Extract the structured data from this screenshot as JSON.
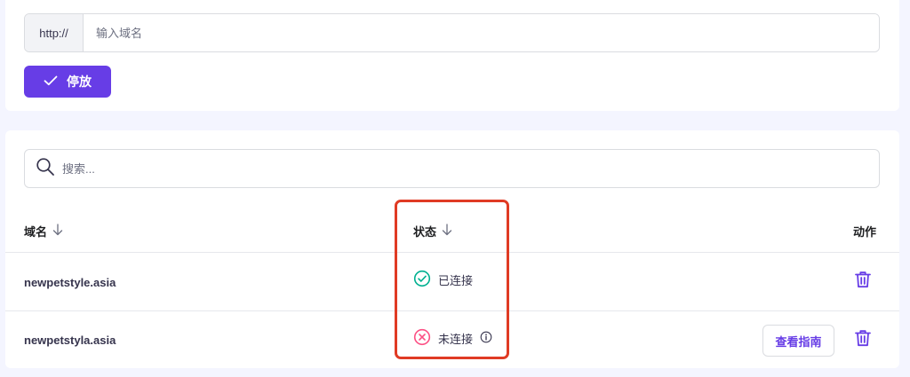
{
  "park_form": {
    "url_prefix": "http://",
    "domain_placeholder": "输入域名",
    "park_button_label": "停放"
  },
  "domains_table": {
    "search_placeholder": "搜索...",
    "columns": {
      "domain": "域名",
      "status": "状态",
      "action": "动作"
    },
    "rows": [
      {
        "domain": "newpetstyle.asia",
        "status": "已连接"
      },
      {
        "domain": "newpetstyla.asia",
        "status": "未连接",
        "guide_button_label": "查看指南"
      }
    ]
  },
  "colors": {
    "primary": "#673de6",
    "connected": "#00b090",
    "disconnected": "#fc5185",
    "highlight": "#e03b24"
  }
}
